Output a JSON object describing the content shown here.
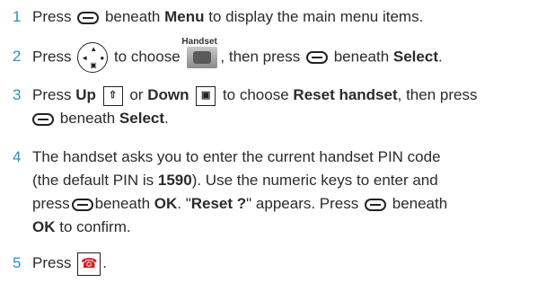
{
  "steps": [
    {
      "num": "1",
      "a": "Press",
      "b": "beneath",
      "menu": "Menu",
      "c": "to display the main menu items."
    },
    {
      "num": "2",
      "a": "Press",
      "b": "to choose",
      "handset_label": "Handset",
      "c": ", then press",
      "d": "beneath",
      "select": "Select",
      "e": "."
    },
    {
      "num": "3",
      "a": "Press",
      "up": "Up",
      "or": "or",
      "down": "Down",
      "b": "to choose",
      "reset": "Reset handset",
      "c": ", then press",
      "d": "beneath",
      "select": "Select",
      "e": "."
    },
    {
      "num": "4",
      "line1": "The handset asks you to enter the current handset PIN code",
      "line2a": "(the default PIN is",
      "pin": "1590",
      "line2b": "). Use the numeric keys to enter and",
      "line3a": "press",
      "line3b": "beneath",
      "ok1": "OK",
      "line3c": ". \"",
      "reset_q": "Reset ?",
      "line3d": "\" appears. Press",
      "line3e": "beneath",
      "ok2": "OK",
      "line4": "to confirm."
    },
    {
      "num": "5",
      "a": "Press",
      "e": "."
    }
  ],
  "icons": {
    "softkey": "softkey-icon",
    "navkey": "nav-key-icon",
    "up": "up-key-icon",
    "down": "down-key-icon",
    "end": "end-call-key-icon",
    "handset": "handset-menu-icon"
  }
}
